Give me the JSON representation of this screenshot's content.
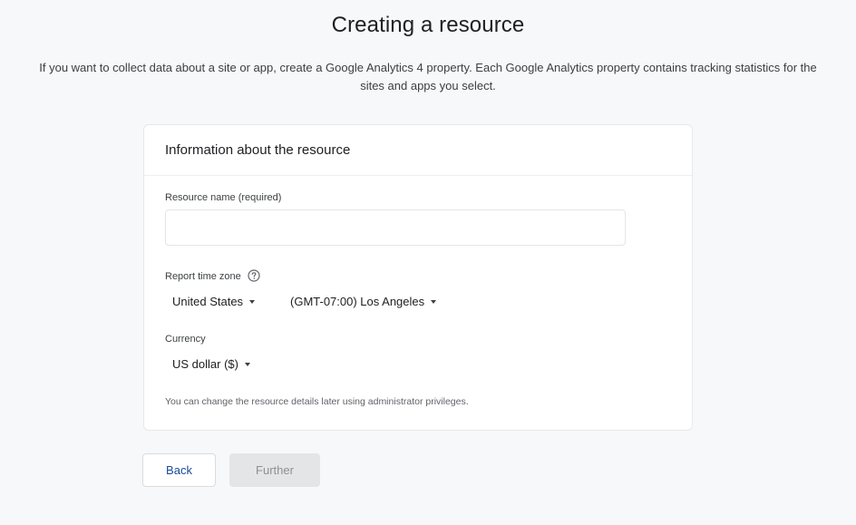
{
  "page": {
    "title": "Creating a resource",
    "intro": "If you want to collect data about a site or app, create a Google Analytics 4 property. Each Google Analytics property contains tracking statistics for the sites and apps you select."
  },
  "card": {
    "header": "Information about the resource",
    "name_field": {
      "label": "Resource name (required)",
      "value": "",
      "placeholder": ""
    },
    "time_zone": {
      "label": "Report time zone",
      "help_icon": "help-circle-icon",
      "country": "United States",
      "zone": "(GMT-07:00) Los Angeles"
    },
    "currency": {
      "label": "Currency",
      "value": "US dollar ($)"
    },
    "footnote": "You can change the resource details later using administrator privileges."
  },
  "actions": {
    "back_label": "Back",
    "further_label": "Further"
  },
  "colors": {
    "background": "#f6f8f9",
    "link_blue": "#1a4a9b",
    "disabled_button": "#e3e5e7"
  }
}
